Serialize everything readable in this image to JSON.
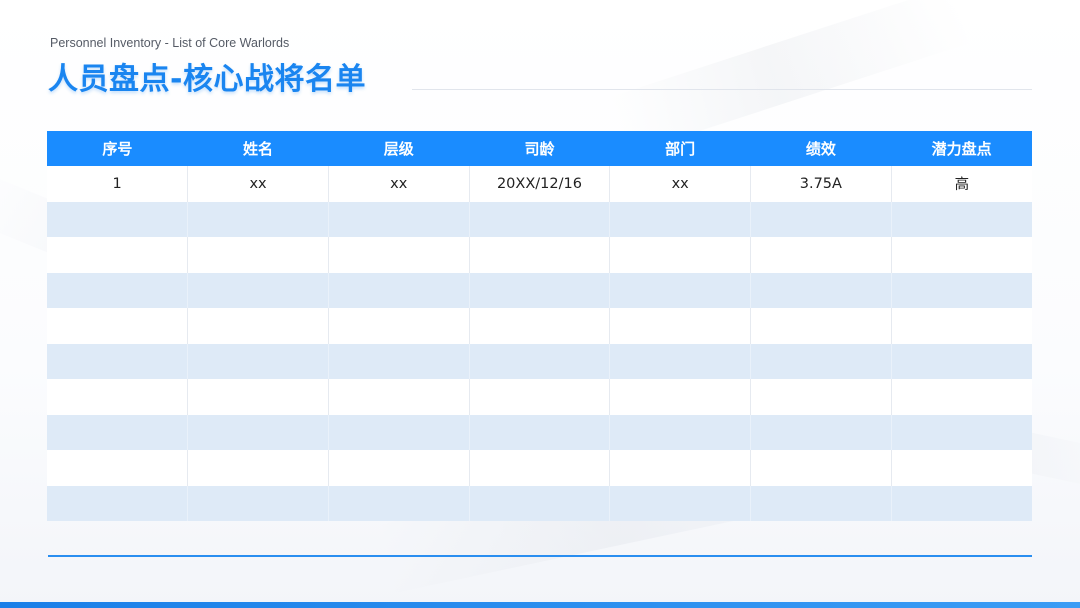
{
  "header": {
    "subtitle": "Personnel Inventory - List of Core Warlords",
    "title": "人员盘点-核心战将名单"
  },
  "table": {
    "columns": [
      "序号",
      "姓名",
      "层级",
      "司龄",
      "部门",
      "绩效",
      "潜力盘点"
    ],
    "rows": [
      [
        "1",
        "xx",
        "xx",
        "20XX/12/16",
        "xx",
        "3.75A",
        "高"
      ],
      [
        "",
        "",
        "",
        "",
        "",
        "",
        ""
      ],
      [
        "",
        "",
        "",
        "",
        "",
        "",
        ""
      ],
      [
        "",
        "",
        "",
        "",
        "",
        "",
        ""
      ],
      [
        "",
        "",
        "",
        "",
        "",
        "",
        ""
      ],
      [
        "",
        "",
        "",
        "",
        "",
        "",
        ""
      ],
      [
        "",
        "",
        "",
        "",
        "",
        "",
        ""
      ],
      [
        "",
        "",
        "",
        "",
        "",
        "",
        ""
      ],
      [
        "",
        "",
        "",
        "",
        "",
        "",
        ""
      ],
      [
        "",
        "",
        "",
        "",
        "",
        "",
        ""
      ]
    ]
  },
  "colors": {
    "accent": "#1a8cff",
    "title": "#1a85f0",
    "row_alt": "#deeaf7"
  }
}
